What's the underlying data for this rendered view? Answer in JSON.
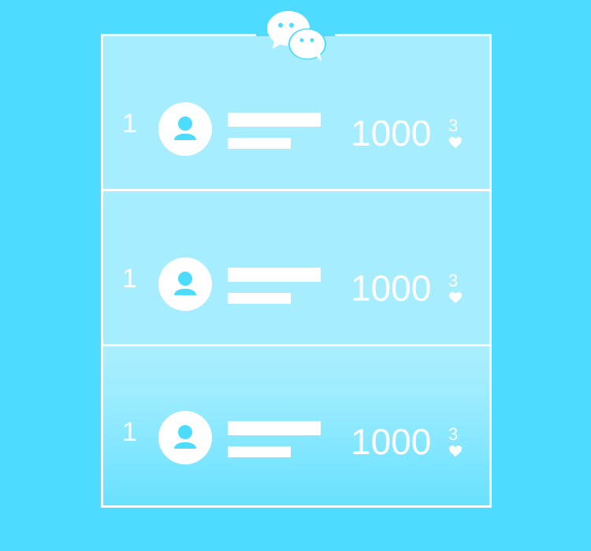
{
  "colors": {
    "background": "#4ddcff",
    "card_fill": "rgba(255,255,255,0.5)",
    "foreground": "#ffffff"
  },
  "header": {
    "icon": "chat-bubbles-icon"
  },
  "rows": [
    {
      "rank": "1",
      "avatar": "user-avatar-icon",
      "score": "1000",
      "likes": "3",
      "like_icon": "heart-icon"
    },
    {
      "rank": "1",
      "avatar": "user-avatar-icon",
      "score": "1000",
      "likes": "3",
      "like_icon": "heart-icon"
    },
    {
      "rank": "1",
      "avatar": "user-avatar-icon",
      "score": "1000",
      "likes": "3",
      "like_icon": "heart-icon"
    }
  ]
}
